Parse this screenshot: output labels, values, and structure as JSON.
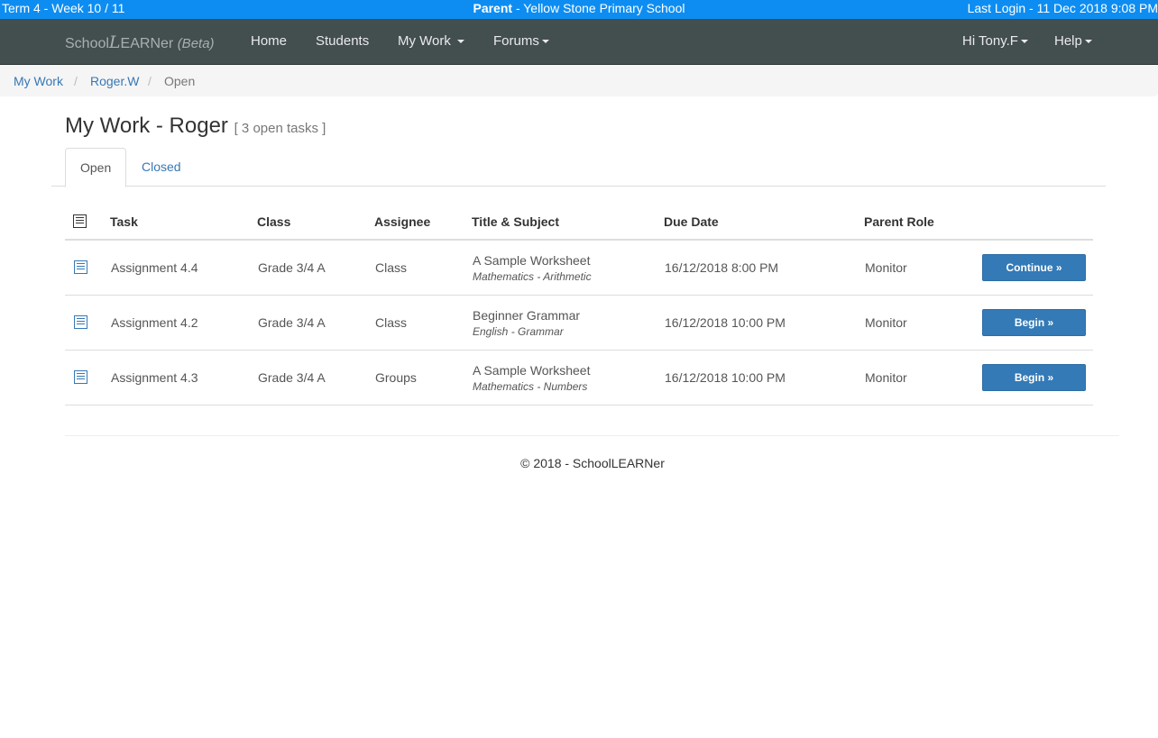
{
  "topbar": {
    "term": "Term 4 - Week 10 / 11",
    "role": "Parent",
    "school": "- Yellow Stone Primary School",
    "last_login": "Last Login - 11 Dec 2018 9:08 PM"
  },
  "navbar": {
    "brand_prefix": "School",
    "brand_script": "L",
    "brand_suffix": "EARNer",
    "brand_beta": "(Beta)",
    "home": "Home",
    "students": "Students",
    "my_work": "My Work",
    "forums": "Forums",
    "user": "Hi Tony.F",
    "help": "Help"
  },
  "breadcrumb": {
    "items": [
      "My Work",
      "Roger.W",
      "Open"
    ],
    "separator": "/"
  },
  "page": {
    "title": "My Work - Roger",
    "subtitle": "[ 3 open tasks ]"
  },
  "tabs": [
    "Open",
    "Closed"
  ],
  "table": {
    "headers": [
      "Task",
      "Class",
      "Assignee",
      "Title & Subject",
      "Due Date",
      "Parent Role"
    ],
    "rows": [
      {
        "task": "Assignment 4.4",
        "class": "Grade 3/4 A",
        "assignee": "Class",
        "title": "A Sample Worksheet",
        "subject": "Mathematics - Arithmetic",
        "due": "16/12/2018 8:00 PM",
        "role": "Monitor",
        "action": "Continue »"
      },
      {
        "task": "Assignment 4.2",
        "class": "Grade 3/4 A",
        "assignee": "Class",
        "title": "Beginner Grammar",
        "subject": "English - Grammar",
        "due": "16/12/2018 10:00 PM",
        "role": "Monitor",
        "action": "Begin »"
      },
      {
        "task": "Assignment 4.3",
        "class": "Grade 3/4 A",
        "assignee": "Groups",
        "title": "A Sample Worksheet",
        "subject": "Mathematics - Numbers",
        "due": "16/12/2018 10:00 PM",
        "role": "Monitor",
        "action": "Begin »"
      }
    ]
  },
  "footer": "© 2018 - SchoolLEARNer",
  "colors": {
    "topbar": "#0d8df2",
    "navbar": "#434e4e",
    "link": "#3778b4",
    "button": "#337ab7"
  }
}
